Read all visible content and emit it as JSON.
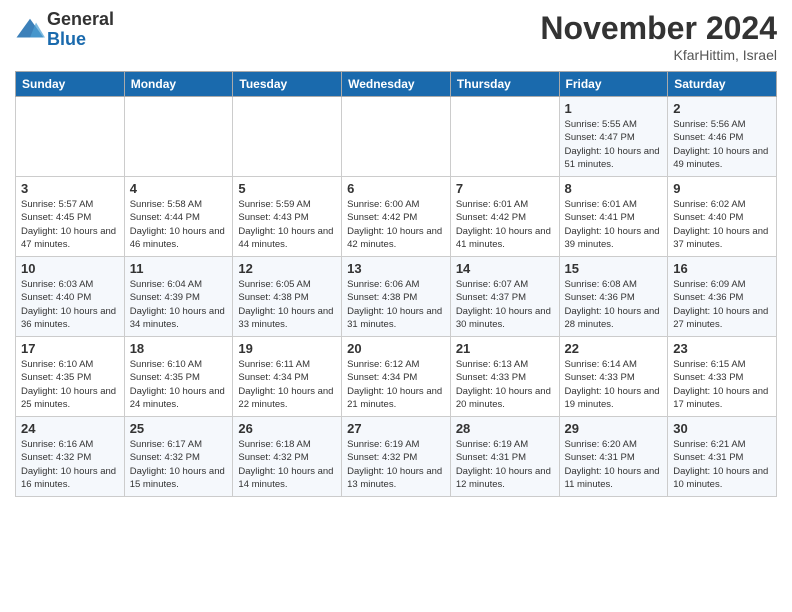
{
  "header": {
    "logo_general": "General",
    "logo_blue": "Blue",
    "title": "November 2024",
    "location": "KfarHittim, Israel"
  },
  "weekdays": [
    "Sunday",
    "Monday",
    "Tuesday",
    "Wednesday",
    "Thursday",
    "Friday",
    "Saturday"
  ],
  "weeks": [
    [
      {
        "day": "",
        "info": ""
      },
      {
        "day": "",
        "info": ""
      },
      {
        "day": "",
        "info": ""
      },
      {
        "day": "",
        "info": ""
      },
      {
        "day": "",
        "info": ""
      },
      {
        "day": "1",
        "info": "Sunrise: 5:55 AM\nSunset: 4:47 PM\nDaylight: 10 hours and 51 minutes."
      },
      {
        "day": "2",
        "info": "Sunrise: 5:56 AM\nSunset: 4:46 PM\nDaylight: 10 hours and 49 minutes."
      }
    ],
    [
      {
        "day": "3",
        "info": "Sunrise: 5:57 AM\nSunset: 4:45 PM\nDaylight: 10 hours and 47 minutes."
      },
      {
        "day": "4",
        "info": "Sunrise: 5:58 AM\nSunset: 4:44 PM\nDaylight: 10 hours and 46 minutes."
      },
      {
        "day": "5",
        "info": "Sunrise: 5:59 AM\nSunset: 4:43 PM\nDaylight: 10 hours and 44 minutes."
      },
      {
        "day": "6",
        "info": "Sunrise: 6:00 AM\nSunset: 4:42 PM\nDaylight: 10 hours and 42 minutes."
      },
      {
        "day": "7",
        "info": "Sunrise: 6:01 AM\nSunset: 4:42 PM\nDaylight: 10 hours and 41 minutes."
      },
      {
        "day": "8",
        "info": "Sunrise: 6:01 AM\nSunset: 4:41 PM\nDaylight: 10 hours and 39 minutes."
      },
      {
        "day": "9",
        "info": "Sunrise: 6:02 AM\nSunset: 4:40 PM\nDaylight: 10 hours and 37 minutes."
      }
    ],
    [
      {
        "day": "10",
        "info": "Sunrise: 6:03 AM\nSunset: 4:40 PM\nDaylight: 10 hours and 36 minutes."
      },
      {
        "day": "11",
        "info": "Sunrise: 6:04 AM\nSunset: 4:39 PM\nDaylight: 10 hours and 34 minutes."
      },
      {
        "day": "12",
        "info": "Sunrise: 6:05 AM\nSunset: 4:38 PM\nDaylight: 10 hours and 33 minutes."
      },
      {
        "day": "13",
        "info": "Sunrise: 6:06 AM\nSunset: 4:38 PM\nDaylight: 10 hours and 31 minutes."
      },
      {
        "day": "14",
        "info": "Sunrise: 6:07 AM\nSunset: 4:37 PM\nDaylight: 10 hours and 30 minutes."
      },
      {
        "day": "15",
        "info": "Sunrise: 6:08 AM\nSunset: 4:36 PM\nDaylight: 10 hours and 28 minutes."
      },
      {
        "day": "16",
        "info": "Sunrise: 6:09 AM\nSunset: 4:36 PM\nDaylight: 10 hours and 27 minutes."
      }
    ],
    [
      {
        "day": "17",
        "info": "Sunrise: 6:10 AM\nSunset: 4:35 PM\nDaylight: 10 hours and 25 minutes."
      },
      {
        "day": "18",
        "info": "Sunrise: 6:10 AM\nSunset: 4:35 PM\nDaylight: 10 hours and 24 minutes."
      },
      {
        "day": "19",
        "info": "Sunrise: 6:11 AM\nSunset: 4:34 PM\nDaylight: 10 hours and 22 minutes."
      },
      {
        "day": "20",
        "info": "Sunrise: 6:12 AM\nSunset: 4:34 PM\nDaylight: 10 hours and 21 minutes."
      },
      {
        "day": "21",
        "info": "Sunrise: 6:13 AM\nSunset: 4:33 PM\nDaylight: 10 hours and 20 minutes."
      },
      {
        "day": "22",
        "info": "Sunrise: 6:14 AM\nSunset: 4:33 PM\nDaylight: 10 hours and 19 minutes."
      },
      {
        "day": "23",
        "info": "Sunrise: 6:15 AM\nSunset: 4:33 PM\nDaylight: 10 hours and 17 minutes."
      }
    ],
    [
      {
        "day": "24",
        "info": "Sunrise: 6:16 AM\nSunset: 4:32 PM\nDaylight: 10 hours and 16 minutes."
      },
      {
        "day": "25",
        "info": "Sunrise: 6:17 AM\nSunset: 4:32 PM\nDaylight: 10 hours and 15 minutes."
      },
      {
        "day": "26",
        "info": "Sunrise: 6:18 AM\nSunset: 4:32 PM\nDaylight: 10 hours and 14 minutes."
      },
      {
        "day": "27",
        "info": "Sunrise: 6:19 AM\nSunset: 4:32 PM\nDaylight: 10 hours and 13 minutes."
      },
      {
        "day": "28",
        "info": "Sunrise: 6:19 AM\nSunset: 4:31 PM\nDaylight: 10 hours and 12 minutes."
      },
      {
        "day": "29",
        "info": "Sunrise: 6:20 AM\nSunset: 4:31 PM\nDaylight: 10 hours and 11 minutes."
      },
      {
        "day": "30",
        "info": "Sunrise: 6:21 AM\nSunset: 4:31 PM\nDaylight: 10 hours and 10 minutes."
      }
    ]
  ]
}
